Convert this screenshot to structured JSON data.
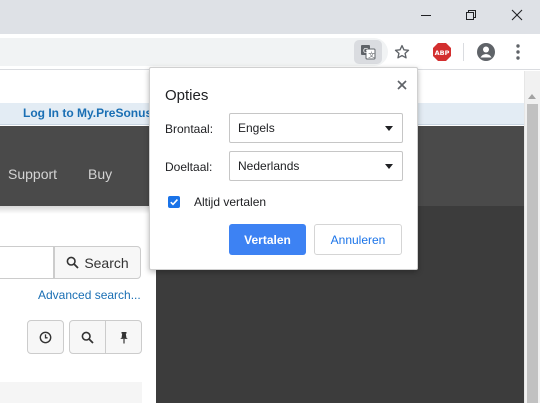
{
  "window_controls": {
    "minimize": "minimize-icon",
    "restore": "restore-icon",
    "close": "close-icon"
  },
  "toolbar": {
    "icons": [
      "translate-icon",
      "star-icon",
      "abp-icon",
      "profile-icon",
      "kebab-menu-icon"
    ],
    "abp_badge": "ABP"
  },
  "page": {
    "login_link": "Log In to My.PreSonus",
    "nav": {
      "support": "Support",
      "buy": "Buy"
    },
    "search_button": "Search",
    "advanced_search": "Advanced search...",
    "tool_icons": [
      "clock-icon",
      "search-icon",
      "pin-icon"
    ]
  },
  "translate_popup": {
    "title": "Opties",
    "source_label": "Brontaal:",
    "source_value": "Engels",
    "target_label": "Doeltaal:",
    "target_value": "Nederlands",
    "always_translate_label": "Altijd vertalen",
    "always_translate_checked": true,
    "translate_button": "Vertalen",
    "cancel_button": "Annuleren"
  },
  "colors": {
    "accent": "#1a73e8",
    "primary_button": "#3d82f3",
    "link": "#1a6fb4",
    "nav_background": "#4a4a4a",
    "dark_panel": "#3c3c3c",
    "abp_red": "#d32f2f"
  }
}
